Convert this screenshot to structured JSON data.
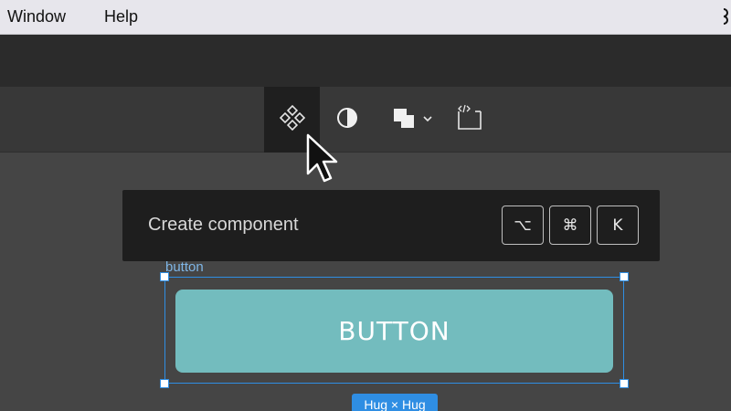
{
  "menubar": {
    "items": [
      "Window",
      "Help"
    ]
  },
  "toolbar": {
    "tools": [
      {
        "name": "create-component",
        "icon": "component-icon",
        "active": true
      },
      {
        "name": "use-as-mask",
        "icon": "mask-icon",
        "active": false
      },
      {
        "name": "boolean-groups",
        "icon": "boolean-union-icon",
        "active": false
      },
      {
        "name": "dev-mode",
        "icon": "code-frame-icon",
        "active": false
      }
    ]
  },
  "tooltip": {
    "label": "Create component",
    "shortcut_keys": [
      "⌥",
      "⌘",
      "K"
    ]
  },
  "canvas": {
    "frame_label": "button",
    "button_text": "BUTTON",
    "size_badge": "Hug × Hug"
  },
  "colors": {
    "selection": "#2f8ee3",
    "button_fill": "#73bcbe",
    "canvas_bg": "#454545",
    "toolbar_bg": "#383838",
    "tooltip_bg": "#1e1e1e"
  }
}
